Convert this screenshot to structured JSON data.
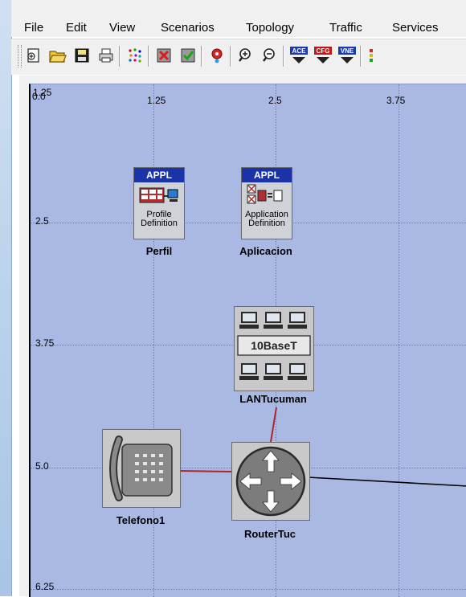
{
  "menu": {
    "items": [
      {
        "label": "File"
      },
      {
        "label": "Edit"
      },
      {
        "label": "View"
      },
      {
        "label": "Scenarios"
      },
      {
        "label": "Topology"
      },
      {
        "label": "Traffic"
      },
      {
        "label": "Services"
      }
    ]
  },
  "toolbar": {
    "buttons": [
      {
        "icon": "new-project-icon"
      },
      {
        "icon": "open-folder-icon"
      },
      {
        "icon": "save-disk-icon"
      },
      {
        "icon": "print-icon"
      },
      {
        "icon": "topology-dots-icon"
      },
      {
        "icon": "fail-node-icon"
      },
      {
        "icon": "recover-node-icon"
      },
      {
        "icon": "pin-marker-icon"
      },
      {
        "icon": "zoom-in-icon"
      },
      {
        "icon": "zoom-out-icon"
      },
      {
        "icon": "ace-icon",
        "badge": "ACE"
      },
      {
        "icon": "cfg-icon",
        "badge": "CFG"
      },
      {
        "icon": "vne-icon",
        "badge": "VNE"
      },
      {
        "icon": "partial-icon"
      }
    ]
  },
  "axis": {
    "x_ticks": [
      "0.0",
      "1.25",
      "2.5",
      "3.75"
    ],
    "y_ticks": [
      "1.25",
      "2.5",
      "3.75",
      "5.0",
      "6.25"
    ]
  },
  "nodes": {
    "perfil": {
      "header": "APPL",
      "line1": "Profile",
      "line2": "Definition",
      "label": "Perfil"
    },
    "aplicacion": {
      "header": "APPL",
      "line1": "Application",
      "line2": "Definition",
      "label": "Aplicacion"
    },
    "lan": {
      "panel": "10BaseT",
      "label": "LANTucuman"
    },
    "telefono": {
      "label": "Telefono1"
    },
    "router": {
      "label": "RouterTuc"
    }
  },
  "colors": {
    "canvas": "#a9b9e4",
    "link_red": "#b0242b",
    "link_black": "#000000",
    "appl_header": "#1b33a8"
  }
}
